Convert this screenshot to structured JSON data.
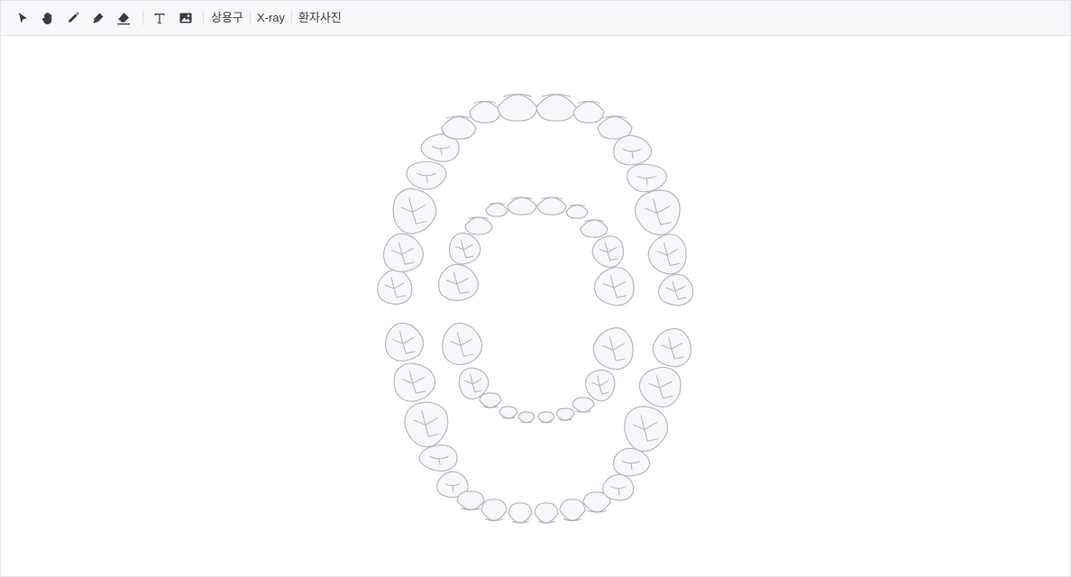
{
  "toolbar": {
    "tools": [
      {
        "name": "select-tool",
        "icon": "pointer-arrow-icon"
      },
      {
        "name": "pan-tool",
        "icon": "hand-icon"
      },
      {
        "name": "pen-tool",
        "icon": "pencil-icon"
      },
      {
        "name": "highlighter-tool",
        "icon": "marker-icon"
      },
      {
        "name": "eraser-tool",
        "icon": "eraser-icon"
      },
      {
        "name": "text-tool",
        "icon": "text-icon"
      },
      {
        "name": "image-tool",
        "icon": "image-icon"
      }
    ],
    "phrases_label": "상용구",
    "xray_label": "X-ray",
    "patient_photo_label": "환자사진"
  },
  "colors": {
    "toolbar_bg": "#f7f7f9",
    "icon": "#3a3b40",
    "tooth_fill": "#f7f7fa",
    "tooth_stroke": "#b5b6c2"
  },
  "dental_chart": {
    "arches": [
      "permanent-upper",
      "primary-upper",
      "permanent-lower",
      "primary-lower"
    ],
    "permanent_teeth_per_arch": 16,
    "primary_teeth_per_arch": 10
  }
}
